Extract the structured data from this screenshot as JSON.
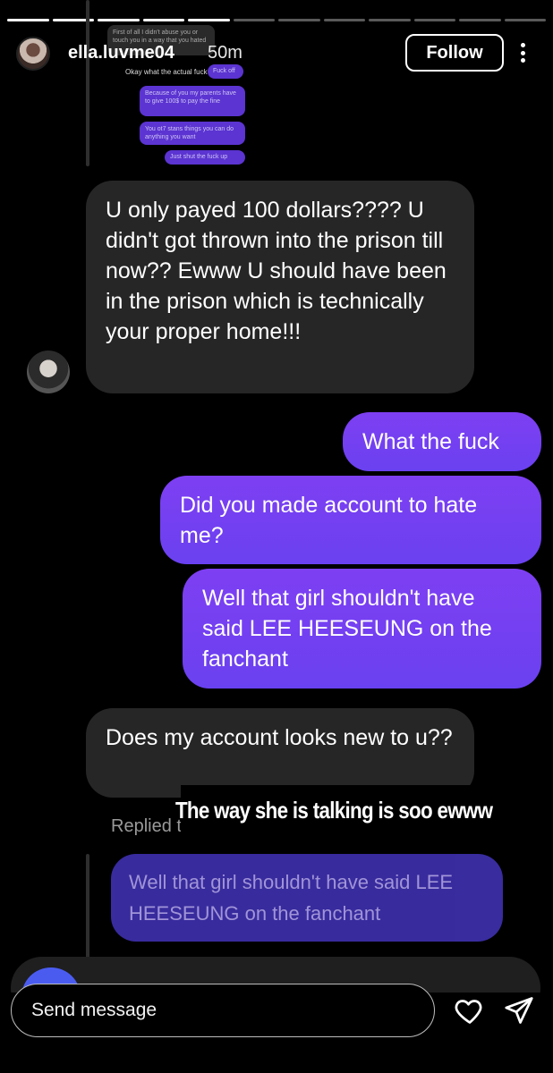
{
  "story": {
    "segments_total": 12,
    "segments_done": 5
  },
  "header": {
    "username": "ella.luvme04",
    "time": "50m",
    "follow_label": "Follow",
    "avatar_icon": "profile-avatar",
    "more_icon": "more-vertical-icon"
  },
  "embedded_screenshot": {
    "lines": [
      "First of all I didn't abuse you or touch you in a way that you hated",
      "Okay what the actual fuck",
      "Fuck off",
      "Because of you my parents have to give 100$ to pay the fine",
      "You ot7 stans things you can do anything you want",
      "Just shut the fuck up"
    ]
  },
  "messages": [
    {
      "direction": "in",
      "text": "U only payed 100 dollars???? U didn't got thrown into the prison till now?? Ewww U should have been in the prison which is technically your proper home!!!"
    },
    {
      "direction": "out",
      "text": "What the fuck"
    },
    {
      "direction": "out",
      "text": "Did you made account to hate me?"
    },
    {
      "direction": "out",
      "text": "Well that girl shouldn't have said LEE HEESEUNG on the fanchant"
    },
    {
      "direction": "in",
      "text": "Does my account looks new to u??"
    }
  ],
  "caption": "The way she is talking is soo ewww",
  "reply": {
    "label": "Replied to you",
    "quoted_text": "Well that girl shouldn't have said LEE HEESEUNG on the fanchant"
  },
  "composer": {
    "placeholder": "Send message",
    "heart_icon": "heart-icon",
    "send_icon": "paper-plane-icon"
  },
  "colors": {
    "incoming_bubble": "#262626",
    "outgoing_bubble": "#7b3ff0",
    "reply_quote": "#3b2ea6",
    "background": "#000000"
  }
}
